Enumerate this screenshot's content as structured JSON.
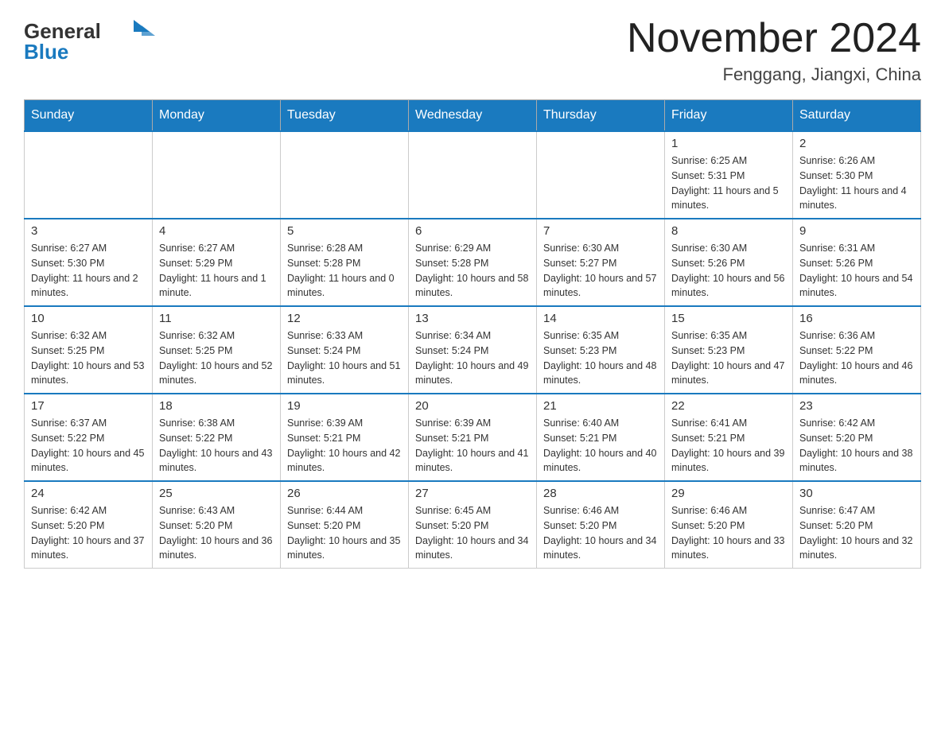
{
  "header": {
    "logo_text_general": "General",
    "logo_text_blue": "Blue",
    "month_title": "November 2024",
    "location": "Fenggang, Jiangxi, China"
  },
  "weekdays": [
    "Sunday",
    "Monday",
    "Tuesday",
    "Wednesday",
    "Thursday",
    "Friday",
    "Saturday"
  ],
  "weeks": [
    [
      {
        "day": "",
        "info": ""
      },
      {
        "day": "",
        "info": ""
      },
      {
        "day": "",
        "info": ""
      },
      {
        "day": "",
        "info": ""
      },
      {
        "day": "",
        "info": ""
      },
      {
        "day": "1",
        "info": "Sunrise: 6:25 AM\nSunset: 5:31 PM\nDaylight: 11 hours and 5 minutes."
      },
      {
        "day": "2",
        "info": "Sunrise: 6:26 AM\nSunset: 5:30 PM\nDaylight: 11 hours and 4 minutes."
      }
    ],
    [
      {
        "day": "3",
        "info": "Sunrise: 6:27 AM\nSunset: 5:30 PM\nDaylight: 11 hours and 2 minutes."
      },
      {
        "day": "4",
        "info": "Sunrise: 6:27 AM\nSunset: 5:29 PM\nDaylight: 11 hours and 1 minute."
      },
      {
        "day": "5",
        "info": "Sunrise: 6:28 AM\nSunset: 5:28 PM\nDaylight: 11 hours and 0 minutes."
      },
      {
        "day": "6",
        "info": "Sunrise: 6:29 AM\nSunset: 5:28 PM\nDaylight: 10 hours and 58 minutes."
      },
      {
        "day": "7",
        "info": "Sunrise: 6:30 AM\nSunset: 5:27 PM\nDaylight: 10 hours and 57 minutes."
      },
      {
        "day": "8",
        "info": "Sunrise: 6:30 AM\nSunset: 5:26 PM\nDaylight: 10 hours and 56 minutes."
      },
      {
        "day": "9",
        "info": "Sunrise: 6:31 AM\nSunset: 5:26 PM\nDaylight: 10 hours and 54 minutes."
      }
    ],
    [
      {
        "day": "10",
        "info": "Sunrise: 6:32 AM\nSunset: 5:25 PM\nDaylight: 10 hours and 53 minutes."
      },
      {
        "day": "11",
        "info": "Sunrise: 6:32 AM\nSunset: 5:25 PM\nDaylight: 10 hours and 52 minutes."
      },
      {
        "day": "12",
        "info": "Sunrise: 6:33 AM\nSunset: 5:24 PM\nDaylight: 10 hours and 51 minutes."
      },
      {
        "day": "13",
        "info": "Sunrise: 6:34 AM\nSunset: 5:24 PM\nDaylight: 10 hours and 49 minutes."
      },
      {
        "day": "14",
        "info": "Sunrise: 6:35 AM\nSunset: 5:23 PM\nDaylight: 10 hours and 48 minutes."
      },
      {
        "day": "15",
        "info": "Sunrise: 6:35 AM\nSunset: 5:23 PM\nDaylight: 10 hours and 47 minutes."
      },
      {
        "day": "16",
        "info": "Sunrise: 6:36 AM\nSunset: 5:22 PM\nDaylight: 10 hours and 46 minutes."
      }
    ],
    [
      {
        "day": "17",
        "info": "Sunrise: 6:37 AM\nSunset: 5:22 PM\nDaylight: 10 hours and 45 minutes."
      },
      {
        "day": "18",
        "info": "Sunrise: 6:38 AM\nSunset: 5:22 PM\nDaylight: 10 hours and 43 minutes."
      },
      {
        "day": "19",
        "info": "Sunrise: 6:39 AM\nSunset: 5:21 PM\nDaylight: 10 hours and 42 minutes."
      },
      {
        "day": "20",
        "info": "Sunrise: 6:39 AM\nSunset: 5:21 PM\nDaylight: 10 hours and 41 minutes."
      },
      {
        "day": "21",
        "info": "Sunrise: 6:40 AM\nSunset: 5:21 PM\nDaylight: 10 hours and 40 minutes."
      },
      {
        "day": "22",
        "info": "Sunrise: 6:41 AM\nSunset: 5:21 PM\nDaylight: 10 hours and 39 minutes."
      },
      {
        "day": "23",
        "info": "Sunrise: 6:42 AM\nSunset: 5:20 PM\nDaylight: 10 hours and 38 minutes."
      }
    ],
    [
      {
        "day": "24",
        "info": "Sunrise: 6:42 AM\nSunset: 5:20 PM\nDaylight: 10 hours and 37 minutes."
      },
      {
        "day": "25",
        "info": "Sunrise: 6:43 AM\nSunset: 5:20 PM\nDaylight: 10 hours and 36 minutes."
      },
      {
        "day": "26",
        "info": "Sunrise: 6:44 AM\nSunset: 5:20 PM\nDaylight: 10 hours and 35 minutes."
      },
      {
        "day": "27",
        "info": "Sunrise: 6:45 AM\nSunset: 5:20 PM\nDaylight: 10 hours and 34 minutes."
      },
      {
        "day": "28",
        "info": "Sunrise: 6:46 AM\nSunset: 5:20 PM\nDaylight: 10 hours and 34 minutes."
      },
      {
        "day": "29",
        "info": "Sunrise: 6:46 AM\nSunset: 5:20 PM\nDaylight: 10 hours and 33 minutes."
      },
      {
        "day": "30",
        "info": "Sunrise: 6:47 AM\nSunset: 5:20 PM\nDaylight: 10 hours and 32 minutes."
      }
    ]
  ]
}
